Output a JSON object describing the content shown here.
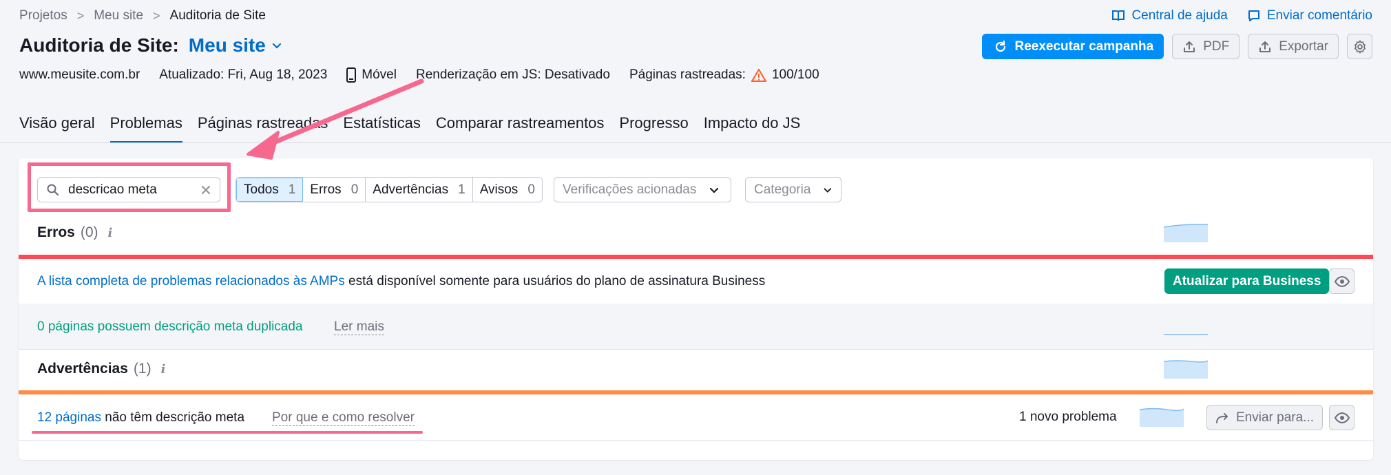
{
  "breadcrumb": {
    "items": [
      "Projetos",
      "Meu site",
      "Auditoria de Site"
    ],
    "separator": ">"
  },
  "top_links": {
    "help": "Central de ajuda",
    "feedback": "Enviar comentário"
  },
  "header": {
    "title": "Auditoria de Site:",
    "project": "Meu site"
  },
  "actions": {
    "rerun": "Reexecutar campanha",
    "pdf": "PDF",
    "export": "Exportar"
  },
  "meta": {
    "domain": "www.meusite.com.br",
    "updated": "Atualizado: Fri, Aug 18, 2023",
    "device": "Móvel",
    "js_rendering": "Renderização em JS: Desativado",
    "crawled_label": "Páginas rastreadas:",
    "crawled_value": "100/100"
  },
  "tabs": [
    {
      "label": "Visão geral",
      "active": false
    },
    {
      "label": "Problemas",
      "active": true
    },
    {
      "label": "Páginas rastreadas",
      "active": false
    },
    {
      "label": "Estatísticas",
      "active": false
    },
    {
      "label": "Comparar rastreamentos",
      "active": false
    },
    {
      "label": "Progresso",
      "active": false
    },
    {
      "label": "Impacto do JS",
      "active": false
    }
  ],
  "search": {
    "value": "descricao meta"
  },
  "filters": [
    {
      "label": "Todos",
      "count": "1",
      "active": true
    },
    {
      "label": "Erros",
      "count": "0",
      "active": false
    },
    {
      "label": "Advertências",
      "count": "1",
      "active": false
    },
    {
      "label": "Avisos",
      "count": "0",
      "active": false
    }
  ],
  "dropdowns": {
    "checks": "Verificações acionadas",
    "category": "Categoria"
  },
  "errors_section": {
    "title": "Erros",
    "count": "(0)",
    "info": "i"
  },
  "amp_notice": {
    "link": "A lista completa de problemas relacionados às AMPs",
    "text": " está disponível somente para usuários do plano de assinatura Business",
    "button": "Atualizar para Business"
  },
  "duplicate_row": {
    "text": "0 páginas possuem descrição meta duplicada",
    "more": "Ler mais"
  },
  "warnings_section": {
    "title": "Advertências",
    "count": "(1)",
    "info": "i"
  },
  "missing_row": {
    "link": "12 páginas",
    "text": " não têm descrição meta",
    "why": "Por que e como resolver",
    "new_issue": "1 novo problema",
    "send": "Enviar para..."
  },
  "colors": {
    "accent": "#006dca",
    "primary_button": "#008ff8",
    "upgrade_button": "#009f81",
    "error_bar": "#ff4953",
    "warning_bar": "#ff8c43",
    "annotation": "#f7688f",
    "success_text": "#009f81"
  }
}
